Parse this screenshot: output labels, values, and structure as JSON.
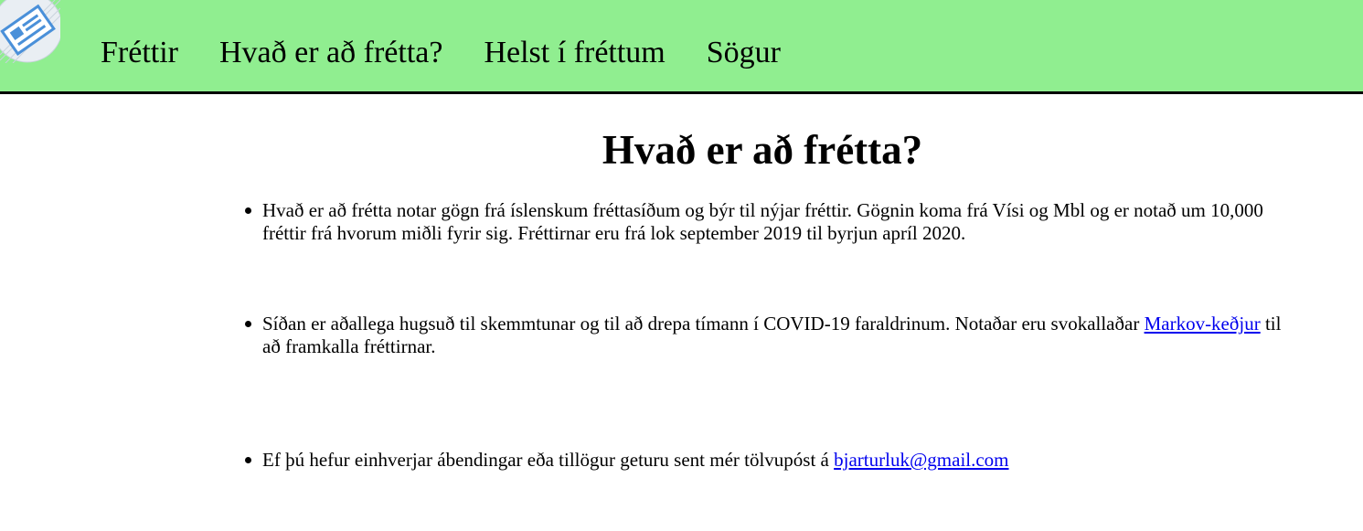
{
  "nav": {
    "logo_icon": "newspaper-icon",
    "items": [
      {
        "label": "Fréttir"
      },
      {
        "label": "Hvað er að frétta?"
      },
      {
        "label": "Helst í fréttum"
      },
      {
        "label": "Sögur"
      }
    ],
    "background_color": "#90ee90"
  },
  "main": {
    "title": "Hvað er að frétta?",
    "items": [
      {
        "text": "Hvað er að frétta notar gögn frá íslenskum fréttasíðum og býr til nýjar fréttir. Gögnin koma frá Vísi og Mbl og er notað um 10,000 fréttir frá hvorum miðli fyrir sig. Fréttirnar eru frá lok september 2019 til byrjun apríl 2020."
      },
      {
        "text_before": "Síðan er aðallega hugsuð til skemmtunar og til að drepa tímann í COVID-19 faraldrinum. Notaðar eru svokallaðar ",
        "link_text": "Markov-keðjur",
        "text_after": " til að framkalla fréttirnar."
      },
      {
        "text_before": "Ef þú hefur einhverjar ábendingar eða tillögur geturu sent mér tölvupóst á ",
        "link_text": "bjarturluk@gmail.com"
      }
    ],
    "link_color": "#0000ee"
  }
}
